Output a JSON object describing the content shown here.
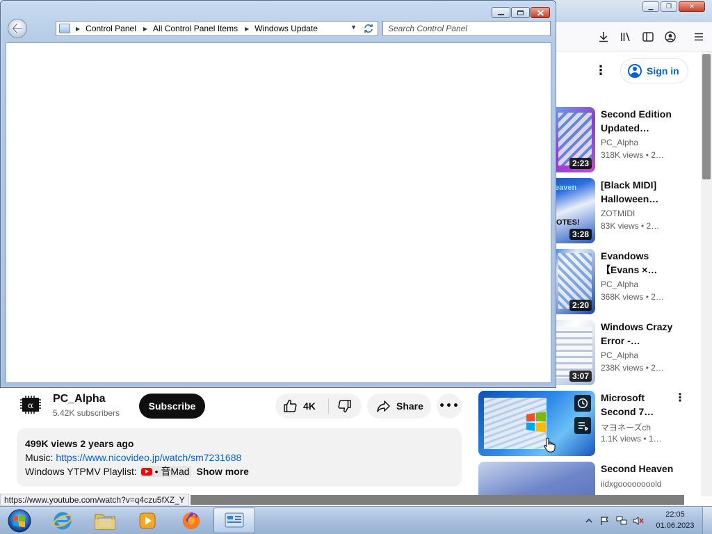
{
  "firefox": {
    "toolbar_icons": [
      "download-icon",
      "library-icon",
      "sidebar-icon",
      "account-icon",
      "menu-icon"
    ]
  },
  "youtube": {
    "sign_in_label": "Sign in",
    "recommendations": [
      {
        "title": "Second Edition Updated…",
        "channel": "PC_Alpha",
        "meta": "318K views  • 2…",
        "duration": "2:23"
      },
      {
        "title": "[Black MIDI] Halloween…",
        "channel": "ZOTMIDI",
        "meta": "83K views  • 2…",
        "duration": "3:28"
      },
      {
        "title": "Evandows 【Evans ×…",
        "channel": "PC_Alpha",
        "meta": "368K views  • 2…",
        "duration": "2:20"
      },
      {
        "title": "Windows Crazy Error -…",
        "channel": "PC_Alpha",
        "meta": "238K views  • 2…",
        "duration": "3:07"
      },
      {
        "title": "Microsoft Second 7…",
        "channel": "マヨネーズch",
        "meta": "1.1K views  • 1…",
        "duration": ""
      },
      {
        "title": "Second Heaven",
        "channel": "iidxgoooooooold",
        "meta": "",
        "duration": ""
      }
    ],
    "channel": {
      "name": "PC_Alpha",
      "subscribers": "5.42K subscribers"
    },
    "subscribe_label": "Subscribe",
    "like_count": "4K",
    "share_label": "Share",
    "more_label": "•••",
    "description": {
      "stats": "499K views  2 years ago",
      "music_label": "Music: ",
      "music_link": "https://www.nicovideo.jp/watch/sm7231688",
      "playlist_label": "Windows YTPMV Playlist: ",
      "playlist_tag": "• 音Mad",
      "show_more": "Show more"
    },
    "status_url": "https://www.youtube.com/watch?v=q4czu5fXZ_Y"
  },
  "explorer": {
    "breadcrumbs": [
      "Control Panel",
      "All Control Panel Items",
      "Windows Update"
    ],
    "search_placeholder": "Search Control Panel"
  },
  "taskbar": {
    "apps": [
      "internet-explorer",
      "windows-explorer",
      "windows-media-player",
      "firefox",
      "control-panel"
    ],
    "time": "22:05",
    "date": "01.06.2023"
  }
}
